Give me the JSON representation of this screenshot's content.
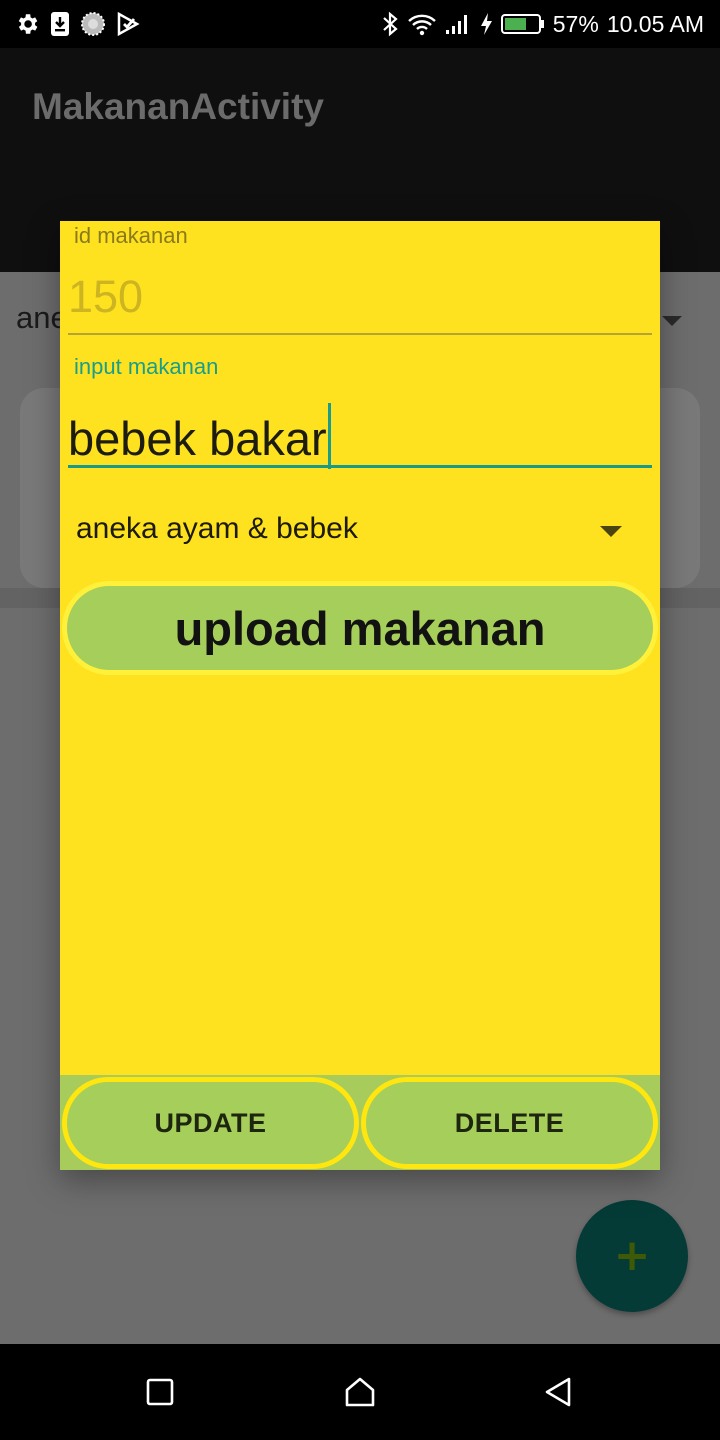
{
  "status_bar": {
    "battery_percent": "57%",
    "time": "10.05 AM",
    "left_icons": [
      "gear-icon",
      "download-icon",
      "loading-icon",
      "play-check-icon"
    ],
    "right_icons": [
      "bluetooth-icon",
      "wifi-icon",
      "signal-icon",
      "charging-icon",
      "battery-icon"
    ]
  },
  "app_bar": {
    "title": "MakananActivity"
  },
  "background": {
    "spinner_text": "aneka ayam & bebek"
  },
  "dialog": {
    "id_label": "id makanan",
    "id_value": "150",
    "name_label": "input makanan",
    "name_value": "bebek bakar",
    "category_value": "aneka ayam & bebek",
    "upload_button": "upload makanan",
    "update_button": "UPDATE",
    "delete_button": "DELETE"
  },
  "fab": {
    "icon": "plus-icon",
    "glyph": "+"
  },
  "nav_bar": {
    "icons": [
      "recents-icon",
      "home-icon",
      "back-icon"
    ]
  },
  "colors": {
    "dialog_background": "#ffe21f",
    "button_green": "#a6ce5a",
    "accent_teal": "#189e8a",
    "fab": "#043b36"
  }
}
